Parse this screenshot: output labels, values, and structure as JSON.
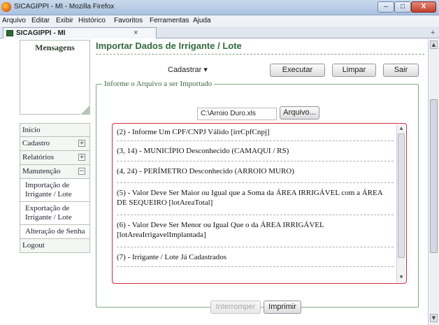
{
  "window": {
    "title": "SICAGIPPI - MI - Mozilla Firefox",
    "minimize_glyph": "–",
    "maximize_glyph": "□",
    "close_glyph": "X"
  },
  "menu": [
    "Arquivo",
    "Editar",
    "Exibir",
    "Histórico",
    "Favoritos",
    "Ferramentas",
    "Ajuda"
  ],
  "tab": {
    "label": "SICAGIPPI - MI",
    "close_glyph": "×",
    "new_tab_glyph": "+"
  },
  "sidebar": {
    "messages_heading": "Mensagens",
    "nav": {
      "inicio": "Início",
      "cadastro": "Cadastro",
      "relatorios": "Relatórios",
      "manutencao": "Manutenção",
      "importacao": "Importação de Irrigante / Lote",
      "exportacao": "Exportação de Irrigante / Lote",
      "alteracao_senha": "Alteração de Senha",
      "logout": "Logout"
    },
    "expand_glyph": "+",
    "collapse_glyph": "−"
  },
  "main": {
    "title": "Importar Dados de Irrigante / Lote",
    "cadastrar_label": "Cadastrar",
    "dropdown_glyph": "▾",
    "buttons": {
      "executar": "Executar",
      "limpar": "Limpar",
      "sair": "Sair"
    },
    "fieldset_legend": "Informe o Arquivo a ser Importado",
    "file_path": "C:\\Arroio Duro.xls",
    "arquivo_button": "Arquivo...",
    "errors": [
      "(2) - Informe Um CPF/CNPJ Válido [irrCpfCnpj]",
      "(3, 14) - MUNICÍPIO Desconhecido (CAMAQUI / RS)",
      "(4, 24) - PERÍMETRO Desconhecido (ARROIO MURO)",
      "(5) - Valor Deve Ser Maior ou Igual que a Soma da ÁREA IRRIGÁVEL com a ÁREA DE SEQUEIRO [lotAreaTotal]",
      "(6) - Valor Deve Ser Menor ou Igual Que o da ÁREA IRRIGÁVEL [lotAreaIrrigavelImplantada]",
      "(7) - Irrigante / Lote Já Cadastrados"
    ],
    "scroll_up_glyph": "▲",
    "scroll_down_glyph": "▼",
    "footer_buttons": {
      "interromper": "Interromper",
      "imprimir": "Imprimir"
    }
  }
}
